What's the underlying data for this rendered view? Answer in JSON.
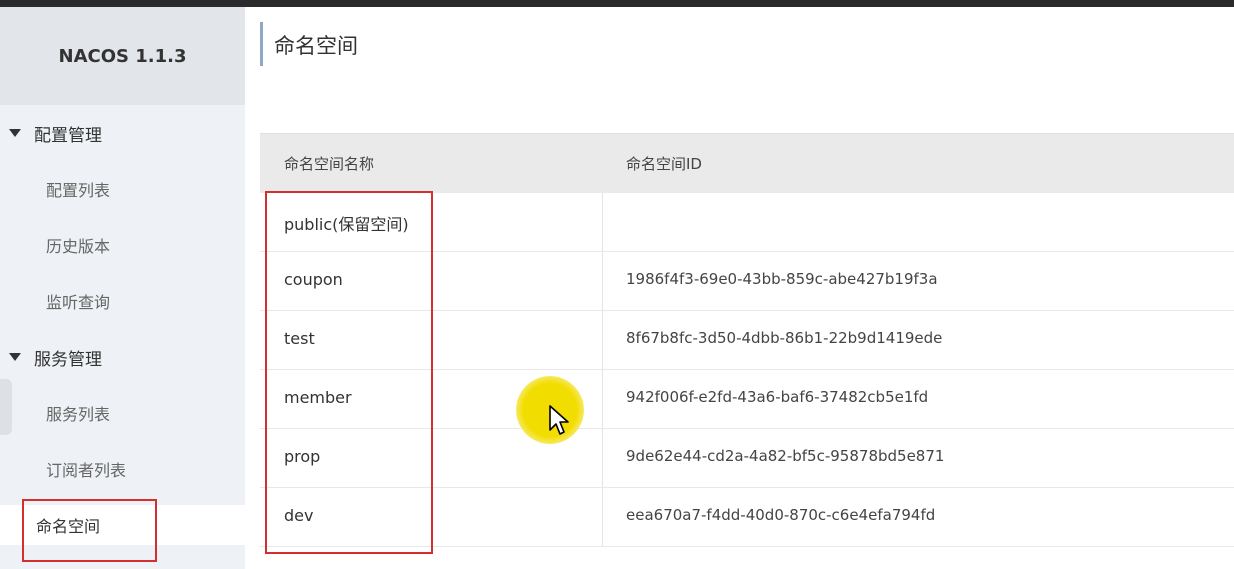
{
  "app": {
    "brand": "NACOS 1.1.3"
  },
  "sidebar": {
    "groups": [
      {
        "label": "配置管理",
        "items": [
          "配置列表",
          "历史版本",
          "监听查询"
        ]
      },
      {
        "label": "服务管理",
        "items": [
          "服务列表",
          "订阅者列表"
        ]
      }
    ],
    "active_item": "命名空间"
  },
  "main": {
    "title": "命名空间",
    "table": {
      "headers": [
        "命名空间名称",
        "命名空间ID"
      ],
      "rows": [
        {
          "name": "public(保留空间)",
          "id": ""
        },
        {
          "name": "coupon",
          "id": "1986f4f3-69e0-43bb-859c-abe427b19f3a"
        },
        {
          "name": "test",
          "id": "8f67b8fc-3d50-4dbb-86b1-22b9d1419ede"
        },
        {
          "name": "member",
          "id": "942f006f-e2fd-43a6-baf6-37482cb5e1fd"
        },
        {
          "name": "prop",
          "id": "9de62e44-cd2a-4a82-bf5c-95878bd5e871"
        },
        {
          "name": "dev",
          "id": "eea670a7-f4dd-40d0-870c-c6e4efa794fd"
        }
      ]
    }
  },
  "colors": {
    "highlight": "#d32f2f",
    "cursor_spot": "#f2dd00"
  }
}
